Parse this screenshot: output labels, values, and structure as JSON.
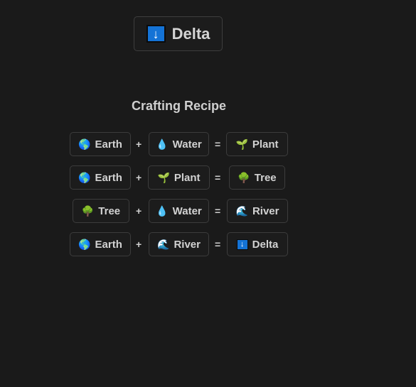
{
  "result": {
    "name": "Delta",
    "icon": "delta-icon",
    "glyph": "↓"
  },
  "recipe_title": "Crafting Recipe",
  "operators": {
    "plus": "+",
    "equals": "="
  },
  "icons": {
    "earth": "🌎",
    "water": "💧",
    "plant": "🌱",
    "tree": "🌳",
    "river": "🌊",
    "delta": "↓"
  },
  "recipes": [
    {
      "a": {
        "name": "Earth",
        "icon": "earth"
      },
      "b": {
        "name": "Water",
        "icon": "water"
      },
      "result": {
        "name": "Plant",
        "icon": "plant"
      }
    },
    {
      "a": {
        "name": "Earth",
        "icon": "earth"
      },
      "b": {
        "name": "Plant",
        "icon": "plant"
      },
      "result": {
        "name": "Tree",
        "icon": "tree"
      }
    },
    {
      "a": {
        "name": "Tree",
        "icon": "tree"
      },
      "b": {
        "name": "Water",
        "icon": "water"
      },
      "result": {
        "name": "River",
        "icon": "river"
      }
    },
    {
      "a": {
        "name": "Earth",
        "icon": "earth"
      },
      "b": {
        "name": "River",
        "icon": "river"
      },
      "result": {
        "name": "Delta",
        "icon": "delta"
      }
    }
  ]
}
